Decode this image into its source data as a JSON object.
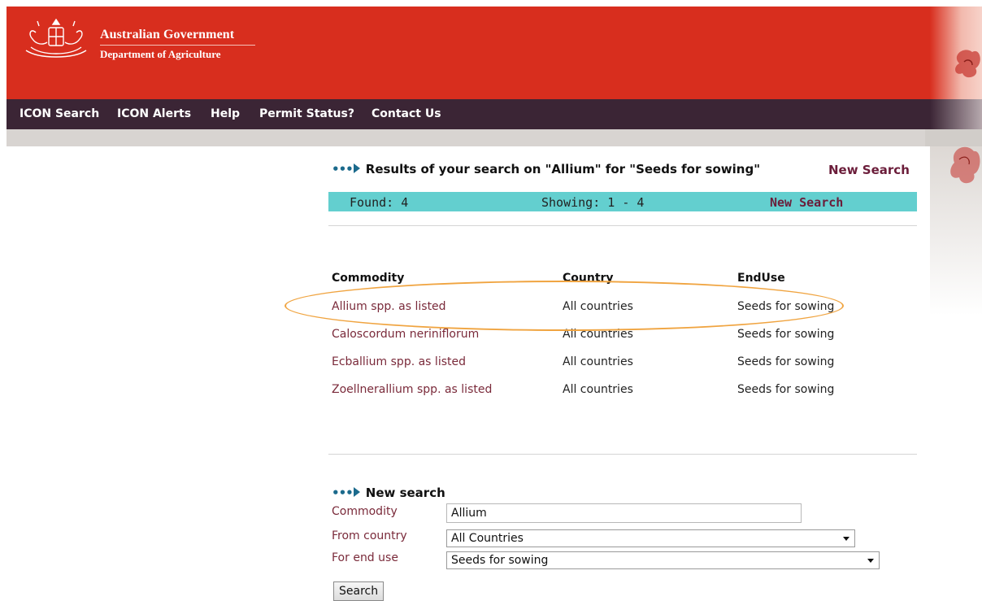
{
  "header": {
    "gov_title": "Australian Government",
    "department": "Department of Agriculture",
    "brand_color": "#d82e1e"
  },
  "nav": {
    "items": [
      "ICON Search",
      "ICON Alerts",
      "Help",
      "Permit Status?",
      "Contact Us"
    ],
    "color": "#3b2535"
  },
  "results": {
    "heading": "Results of your search on \"Allium\" for \"Seeds for sowing\"",
    "new_search_link": "New Search",
    "found": "Found: 4",
    "showing": "Showing: 1 - 4",
    "bar_new_search": "New Search",
    "bar_color": "#63cfcf"
  },
  "table": {
    "headers": [
      "Commodity",
      "Country",
      "EndUse"
    ],
    "rows": [
      [
        "Allium spp. as listed",
        "All countries",
        "Seeds for sowing"
      ],
      [
        "Caloscordum neriniflorum",
        "All countries",
        "Seeds for sowing"
      ],
      [
        "Ecballium spp. as listed",
        "All countries",
        "Seeds for sowing"
      ],
      [
        "Zoellnerallium spp. as listed",
        "All countries",
        "Seeds for sowing"
      ]
    ]
  },
  "new_search": {
    "heading": "New search",
    "commodity_label": "Commodity",
    "commodity_value": "Allium",
    "country_label": "From country",
    "country_value": "All Countries",
    "enduse_label": "For end use",
    "enduse_value": "Seeds for sowing",
    "button": "Search"
  }
}
